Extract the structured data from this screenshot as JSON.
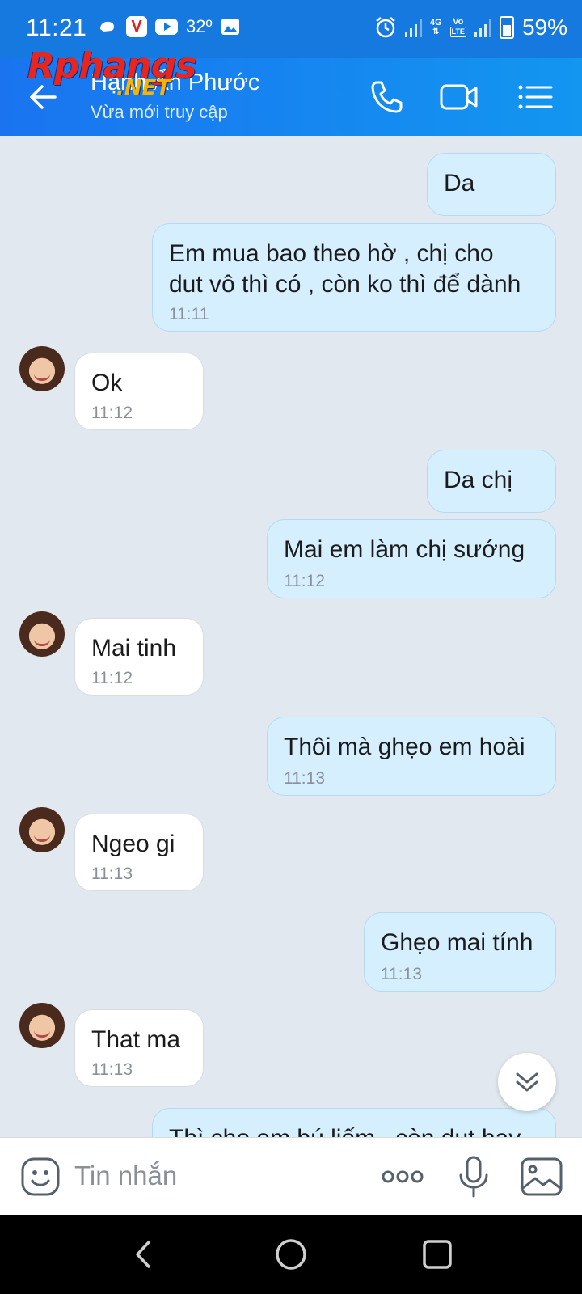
{
  "status_bar": {
    "time": "11:21",
    "temperature": "32º",
    "network": "4G",
    "network_sub": "LTE",
    "volte": "Vo",
    "battery": "59%",
    "icons": [
      "notification-dot-icon",
      "v-app-icon",
      "youtube-icon",
      "image-icon",
      "alarm-icon",
      "signal-icon",
      "battery-icon"
    ]
  },
  "header": {
    "contact_name": "Hạnh Ẩn Phước",
    "status": "Vừa mới truy cập",
    "watermark_main": "Rphangs",
    "watermark_sub": ".NET",
    "icons": [
      "back-arrow-icon",
      "phone-icon",
      "video-call-icon",
      "menu-list-icon"
    ]
  },
  "messages": [
    {
      "sender": "me",
      "text": "Da",
      "time": ""
    },
    {
      "sender": "me",
      "text": "Em mua bao theo hờ , chị cho",
      "text2": "dut vô thì có , còn ko thì để dành",
      "time": "11:11"
    },
    {
      "sender": "other",
      "text": "Ok",
      "time": "11:12"
    },
    {
      "sender": "me",
      "text": "Da chị",
      "time": ""
    },
    {
      "sender": "me",
      "text": "Mai em làm chị sướng",
      "time": "11:12"
    },
    {
      "sender": "other",
      "text": "Mai tinh",
      "time": "11:12"
    },
    {
      "sender": "me",
      "text": "Thôi mà ghẹo em hoài",
      "time": "11:13"
    },
    {
      "sender": "other",
      "text": "Ngeo gi",
      "time": "11:13"
    },
    {
      "sender": "me",
      "text": "Ghẹo mai tính",
      "time": "11:13"
    },
    {
      "sender": "other",
      "text": "That ma",
      "time": "11:13"
    },
    {
      "sender": "me",
      "text": "Thì cho em bú liếm , còn dut hay",
      "time": ""
    }
  ],
  "input": {
    "placeholder": "Tin nhắn",
    "icons": [
      "emoji-icon",
      "more-options-icon",
      "microphone-icon",
      "image-picker-icon"
    ]
  },
  "colors": {
    "header_blue": "#1579e0",
    "bubble_me": "#d5efff",
    "bubble_other": "#ffffff",
    "chat_background": "#e2e8ef"
  }
}
